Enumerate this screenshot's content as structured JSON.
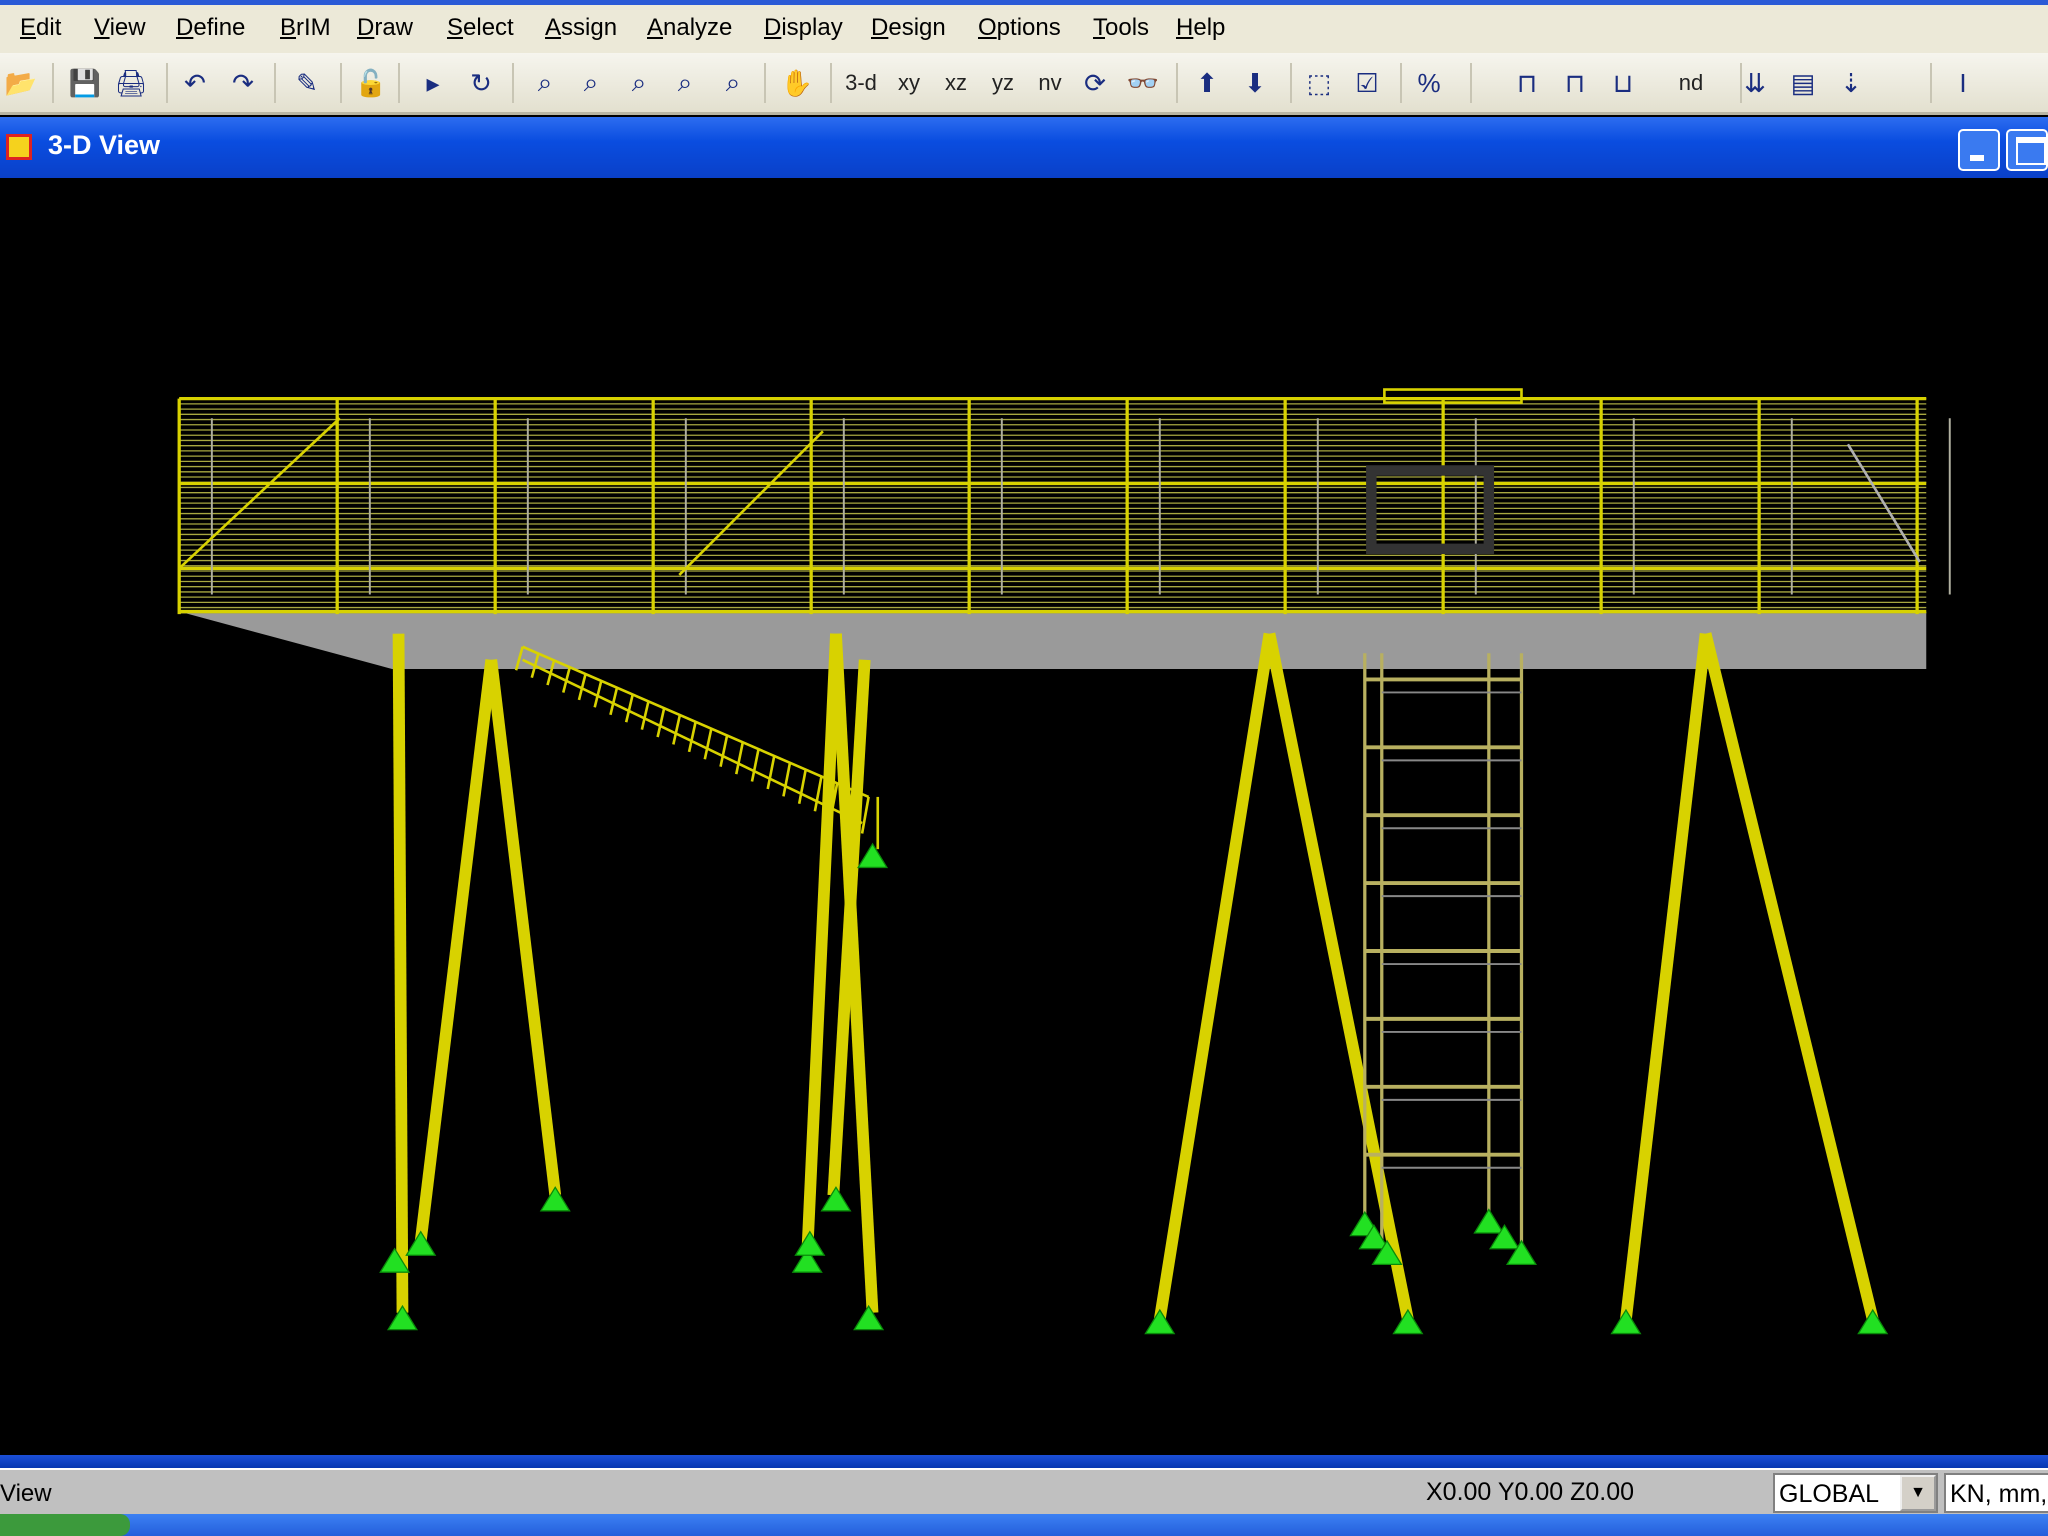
{
  "menu": [
    "Edit",
    "View",
    "Define",
    "BrIM",
    "Draw",
    "Select",
    "Assign",
    "Analyze",
    "Display",
    "Design",
    "Options",
    "Tools",
    "Help"
  ],
  "toolbar": {
    "icons": [
      "open-icon",
      "save-icon",
      "print-icon",
      "undo-icon",
      "redo-icon",
      "pencil-icon",
      "lock-icon",
      "run-icon",
      "rotate-icon",
      "zoom-window-icon",
      "zoom-restore-icon",
      "zoom-previous-icon",
      "zoom-in-icon",
      "zoom-out-icon",
      "pan-icon"
    ],
    "view_labels": [
      "3-d",
      "xy",
      "xz",
      "yz",
      "nv"
    ],
    "icons2": [
      "refresh-icon",
      "perspective-icon",
      "up-icon",
      "down-icon",
      "shrink-icon",
      "check-icon",
      "percent-icon"
    ],
    "icons3": [
      "frame-icon",
      "frame-template-icon",
      "bridge-icon"
    ],
    "nd_label": "nd",
    "icons4": [
      "load-icon",
      "load-display-icon",
      "load-case-icon",
      "section-icon"
    ]
  },
  "window": {
    "title": "3-D View"
  },
  "status": {
    "left": "View",
    "coords": "X0.00 Y0.00 Z0.00",
    "coord_system": "GLOBAL",
    "units": "KN, mm, C"
  },
  "colors": {
    "members": "#d8d200",
    "supports": "#22e022",
    "deck_floor": "#9a9a9a"
  }
}
